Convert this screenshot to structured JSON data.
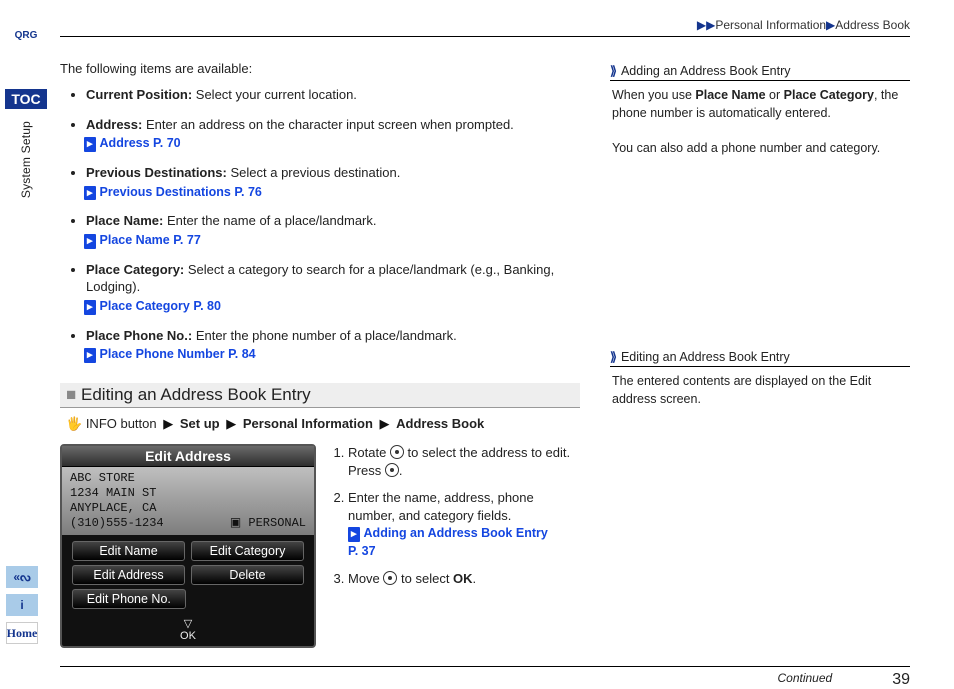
{
  "breadcrumb": {
    "a": "Personal Information",
    "b": "Address Book"
  },
  "rail": {
    "qrg": "QRG",
    "toc": "TOC",
    "section": "System Setup",
    "home": "Home"
  },
  "intro": "The following items are available:",
  "items": [
    {
      "term": "Current Position:",
      "desc": " Select your current location."
    },
    {
      "term": "Address:",
      "desc": " Enter an address on the character input screen when prompted.",
      "xref": "Address",
      "page": "P. 70"
    },
    {
      "term": "Previous Destinations:",
      "desc": " Select a previous destination.",
      "xref": "Previous Destinations",
      "page": "P. 76"
    },
    {
      "term": "Place Name:",
      "desc": " Enter the name of a place/landmark.",
      "xref": "Place Name",
      "page": "P. 77"
    },
    {
      "term": "Place Category:",
      "desc": " Select a category to search for a place/landmark (e.g., Banking, Lodging).",
      "xref": "Place Category",
      "page": "P. 80"
    },
    {
      "term": "Place Phone No.:",
      "desc": " Enter the phone number of a place/landmark.",
      "xref": "Place Phone Number",
      "page": "P. 84"
    }
  ],
  "subheading": "Editing an Address Book Entry",
  "navpath": {
    "pre": "INFO button",
    "a": "Set up",
    "b": "Personal Information",
    "c": "Address Book"
  },
  "screen": {
    "title": "Edit Address",
    "loc_name": "ABC STORE",
    "loc_addr": "1234 MAIN ST",
    "loc_city": "ANYPLACE, CA",
    "loc_phone": "(310)555-1234",
    "tag": "PERSONAL",
    "b1": "Edit Name",
    "b2": "Edit Category",
    "b3": "Edit Address",
    "b4": "Delete",
    "b5": "Edit Phone No.",
    "ok": "OK"
  },
  "steps": [
    {
      "pre": "Rotate ",
      "post": " to select the address to edit. Press ",
      "end": "."
    },
    {
      "text": "Enter the name, address, phone number, and category fields.",
      "xref": "Adding an Address Book Entry",
      "page": "P. 37"
    },
    {
      "pre": "Move ",
      "post": " to select ",
      "bold": "OK",
      "end": "."
    }
  ],
  "side": {
    "note1_title": "Adding an Address Book Entry",
    "note1_p1a": "When you use ",
    "note1_b1": "Place Name",
    "note1_mid": " or ",
    "note1_b2": "Place Category",
    "note1_p1b": ", the phone number is automatically entered.",
    "note1_p2": "You can also add a phone number and category.",
    "note2_title": "Editing an Address Book Entry",
    "note2_p1": "The entered contents are displayed on the Edit address screen."
  },
  "footer": {
    "continued": "Continued",
    "page": "39"
  }
}
